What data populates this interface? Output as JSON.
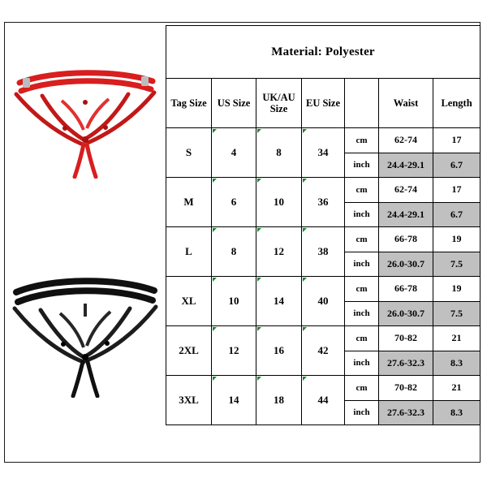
{
  "page": {
    "background_color": "#ffffff",
    "border_color": "#1a1a1a"
  },
  "product_images": [
    {
      "name": "red-thong-photo",
      "color_label": "red",
      "color_hex": "#d81e1e",
      "alt": "Red strappy cut-out thong panty"
    },
    {
      "name": "black-thong-photo",
      "color_label": "black",
      "color_hex": "#101010",
      "alt": "Black strappy cut-out thong panty"
    }
  ],
  "table": {
    "title": "Material: Polyester",
    "shade_color": "#c0c0c0",
    "marker_color": "#128a28",
    "headers": {
      "tag_size": "Tag Size",
      "us_size": "US Size",
      "uk_au_size": "UK/AU Size",
      "eu_size": "EU Size",
      "unit": "",
      "waist": "Waist",
      "length": "Length"
    },
    "units": {
      "cm": "cm",
      "inch": "inch"
    },
    "rows": [
      {
        "tag_size": "S",
        "us_size": "4",
        "uk_au_size": "8",
        "eu_size": "34",
        "waist_cm": "62-74",
        "length_cm": "17",
        "waist_inch": "24.4-29.1",
        "length_inch": "6.7"
      },
      {
        "tag_size": "M",
        "us_size": "6",
        "uk_au_size": "10",
        "eu_size": "36",
        "waist_cm": "62-74",
        "length_cm": "17",
        "waist_inch": "24.4-29.1",
        "length_inch": "6.7"
      },
      {
        "tag_size": "L",
        "us_size": "8",
        "uk_au_size": "12",
        "eu_size": "38",
        "waist_cm": "66-78",
        "length_cm": "19",
        "waist_inch": "26.0-30.7",
        "length_inch": "7.5"
      },
      {
        "tag_size": "XL",
        "us_size": "10",
        "uk_au_size": "14",
        "eu_size": "40",
        "waist_cm": "66-78",
        "length_cm": "19",
        "waist_inch": "26.0-30.7",
        "length_inch": "7.5"
      },
      {
        "tag_size": "2XL",
        "us_size": "12",
        "uk_au_size": "16",
        "eu_size": "42",
        "waist_cm": "70-82",
        "length_cm": "21",
        "waist_inch": "27.6-32.3",
        "length_inch": "8.3"
      },
      {
        "tag_size": "3XL",
        "us_size": "14",
        "uk_au_size": "18",
        "eu_size": "44",
        "waist_cm": "70-82",
        "length_cm": "21",
        "waist_inch": "27.6-32.3",
        "length_inch": "8.3"
      }
    ]
  }
}
